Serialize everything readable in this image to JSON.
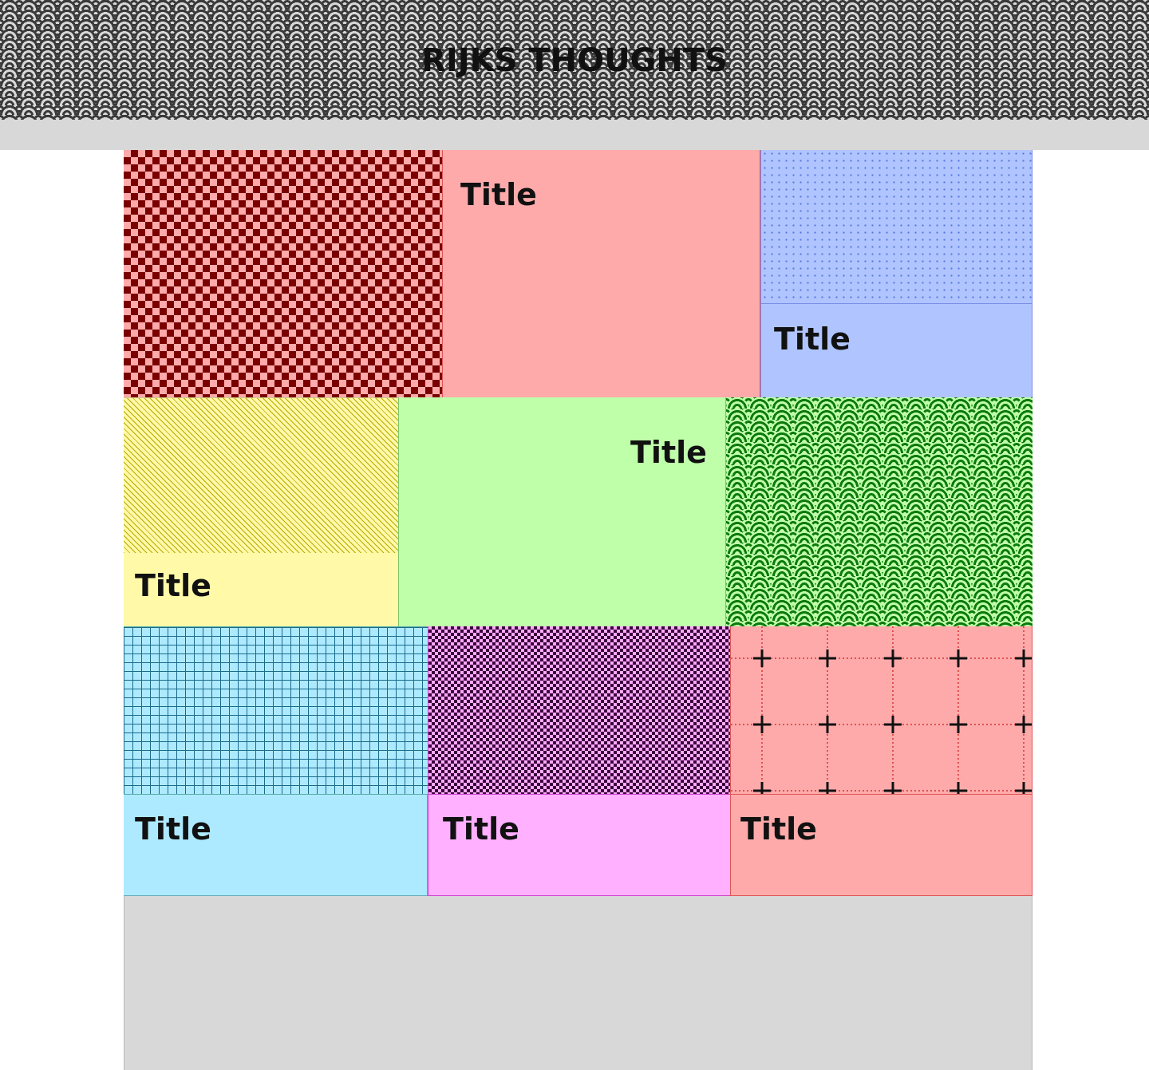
{
  "header": {
    "site_title": "RIJKS THOUGHTS"
  },
  "tiles": [
    {
      "title": "",
      "color": "#ffaaaa",
      "pattern": "checker",
      "pattern_color": "#7a0000"
    },
    {
      "title": "Title",
      "color": "#ffaaaa",
      "pattern": "none"
    },
    {
      "title": "Title",
      "color": "#b0c4ff",
      "pattern": "dots",
      "pattern_color": "#5577dd"
    },
    {
      "title": "Title",
      "color": "#fff9a8",
      "pattern": "diagonal-stripes",
      "pattern_color": "#b8a800"
    },
    {
      "title": "Title",
      "color": "#bfffaa",
      "pattern": "none"
    },
    {
      "title": "",
      "color": "#bfffaa",
      "pattern": "scales",
      "pattern_color": "#0b7a0b"
    },
    {
      "title": "Title",
      "color": "#aeeaff",
      "pattern": "grid",
      "pattern_color": "#1a6a8a"
    },
    {
      "title": "Title",
      "color": "#ffb0ff",
      "pattern": "checker",
      "pattern_color": "#3a003a"
    },
    {
      "title": "Title",
      "color": "#ffaaaa",
      "pattern": "crosses",
      "pattern_color": "#111111"
    }
  ]
}
